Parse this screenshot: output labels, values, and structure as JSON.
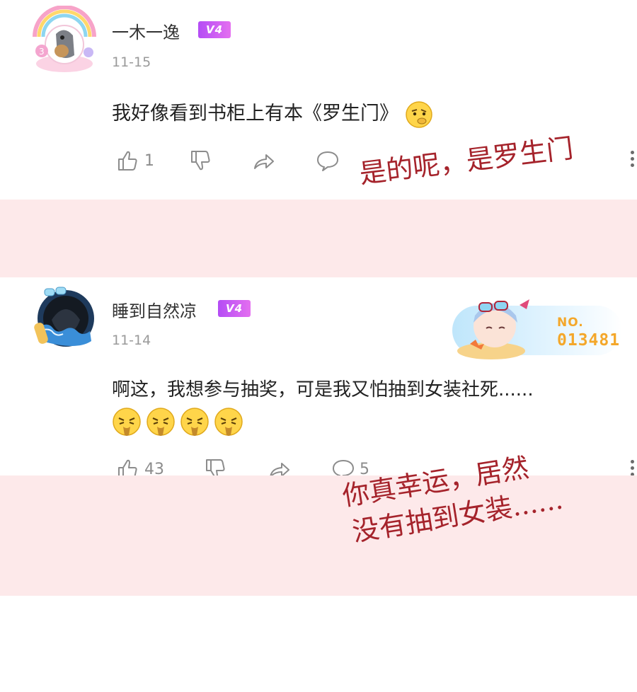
{
  "comments": [
    {
      "username": "一木一逸",
      "level_badge": "V4",
      "date": "11-15",
      "text": "我好像看到书柜上有本《罗生门》",
      "likes": "1",
      "replies": ""
    },
    {
      "username": "睡到自然凉",
      "level_badge": "V4",
      "date": "11-14",
      "text": "啊这，我想参与抽奖，可是我又怕抽到女装社死......",
      "likes": "43",
      "replies": "5",
      "fan_card": {
        "label": "NO.",
        "number": "013481"
      }
    }
  ],
  "annotations": {
    "note1": "是的呢，是罗生门",
    "note2_line1": "你真幸运，居然",
    "note2_line2": "没有抽到女装......"
  },
  "colors": {
    "band": "#fde9ea",
    "badge": "#b44cf5",
    "handwriting": "#a5232b",
    "fan_number": "#f4a72a"
  }
}
